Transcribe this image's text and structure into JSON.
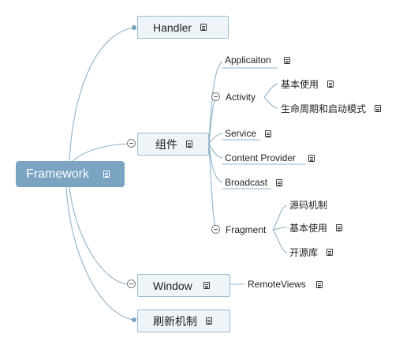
{
  "root": {
    "label": "Framework"
  },
  "nodes": {
    "handler": "Handler",
    "components": "组件",
    "window": "Window",
    "refresh": "刷新机制"
  },
  "components": {
    "application": "Applicaiton",
    "activity": "Activity",
    "activity_basic": "基本使用",
    "activity_lifecycle": "生命周期和启动模式",
    "service": "Service",
    "content_provider": "Content Provider",
    "broadcast": "Broadcast",
    "fragment": "Fragment",
    "fragment_source": "源码机制",
    "fragment_basic": "基本使用",
    "fragment_opensource": "开源库"
  },
  "window": {
    "remote_views": "RemoteViews"
  },
  "icons": {
    "note": "note-icon",
    "collapse": "collapse-toggle-icon",
    "expand": "expand-dot-icon"
  },
  "colors": {
    "root_fill": "#7ba3c2",
    "node_fill": "#eef4f8",
    "node_border": "#9dbdd3",
    "line": "#8fb3c9"
  }
}
